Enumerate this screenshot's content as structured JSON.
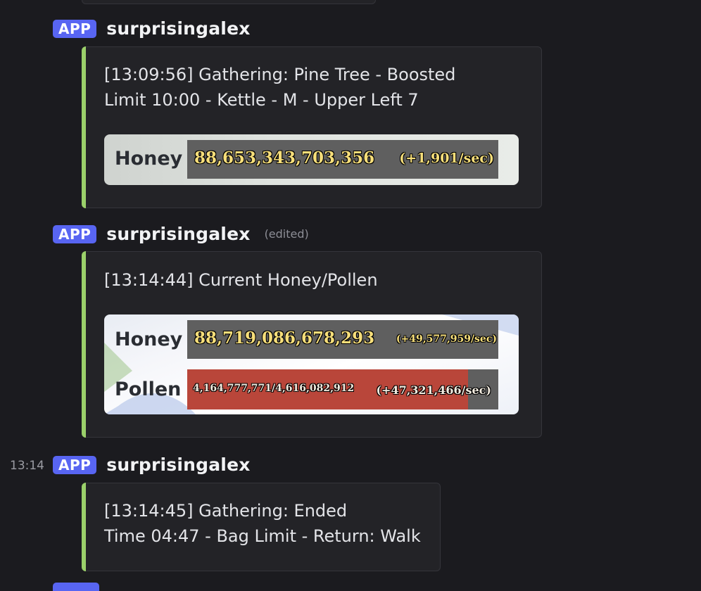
{
  "messages": [
    {
      "badge": "APP",
      "username": "surprisingalex",
      "text_lines": [
        "[13:09:56] Gathering: Pine Tree - Boosted",
        "Limit 10:00 - Kettle - M - Upper Left 7"
      ],
      "stats": {
        "honey_label": "Honey",
        "honey_value": "88,653,343,703,356",
        "honey_rate": "(+1,901/sec)"
      }
    },
    {
      "badge": "APP",
      "username": "surprisingalex",
      "edited": "(edited)",
      "text_lines": [
        "[13:14:44] Current Honey/Pollen"
      ],
      "stats": {
        "honey_label": "Honey",
        "honey_value": "88,719,086,678,293",
        "honey_rate": "(+49,577,959/sec)",
        "pollen_label": "Pollen",
        "pollen_value": "4,164,777,771/4,616,082,912",
        "pollen_rate": "(+47,321,466/sec)",
        "pollen_fill_fraction": 0.902
      }
    },
    {
      "timestamp": "13:14",
      "badge": "APP",
      "username": "surprisingalex",
      "text_lines": [
        "[13:14:45] Gathering: Ended",
        "Time 04:47 - Bag Limit - Return: Walk"
      ]
    }
  ],
  "colors": {
    "background": "#1b1b1f",
    "embed_accent": "#9bd06a",
    "app_badge": "#5865f2",
    "pollen_fill": "#b9463a"
  }
}
